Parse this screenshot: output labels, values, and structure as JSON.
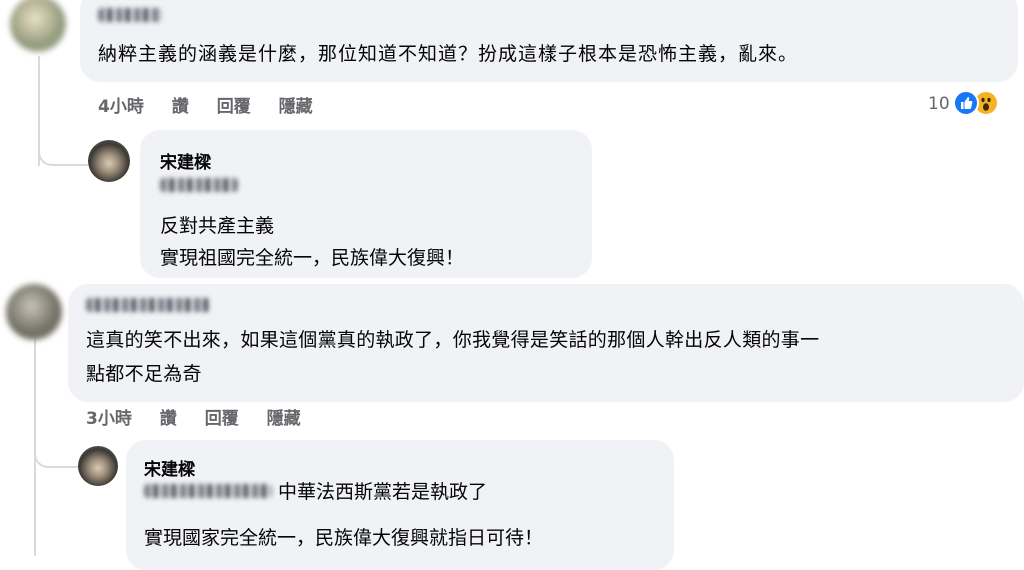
{
  "comments": [
    {
      "text": "納粹主義的涵義是什麼，那位知道不知道？扮成這樣子根本是恐怖主義，亂來。",
      "time": "4小時",
      "like": "讚",
      "reply": "回覆",
      "hide": "隱藏",
      "reaction_count": "10",
      "reactions": [
        "like-icon",
        "wow-icon"
      ],
      "replies": [
        {
          "author": "宋建樑",
          "lines": [
            "反對共產主義",
            "實現祖國完全統一，民族偉大復興！"
          ]
        }
      ]
    },
    {
      "text_line1": "這真的笑不出來，如果這個黨真的執政了，你我覺得是笑話的那個人幹出反人類的事一",
      "text_line2": "點都不足為奇",
      "time": "3小時",
      "like": "讚",
      "reply": "回覆",
      "hide": "隱藏",
      "replies": [
        {
          "author": "宋建樑",
          "line1": "中華法西斯黨若是執政了",
          "line2": "實現國家完全統一，民族偉大復興就指日可待！"
        }
      ]
    }
  ],
  "colors": {
    "bubble": "#f0f2f5",
    "meta": "#65676b",
    "like_blue": "#1877f2",
    "wow_yellow": "#f7b125"
  }
}
